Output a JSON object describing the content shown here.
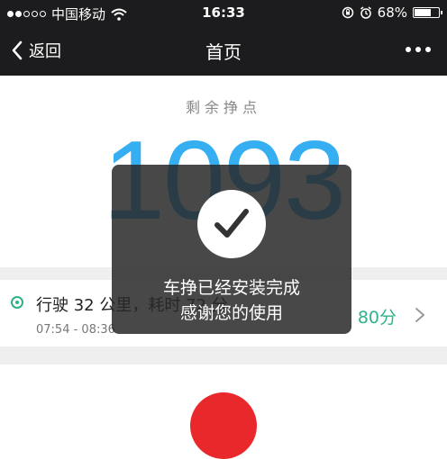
{
  "status_bar": {
    "carrier": "中国移动",
    "time": "16:33",
    "battery_percent": "68%",
    "battery_level": 0.68
  },
  "nav": {
    "back_label": "返回",
    "title": "首页"
  },
  "summary": {
    "label": "剩余挣点",
    "value": "1093"
  },
  "trip": {
    "title": "行驶 32 公里，耗时 72 分",
    "time_range": "07:54 - 08:36",
    "score": "80分"
  },
  "toast": {
    "line1": "车挣已经安装完成",
    "line2": "感谢您的使用"
  }
}
